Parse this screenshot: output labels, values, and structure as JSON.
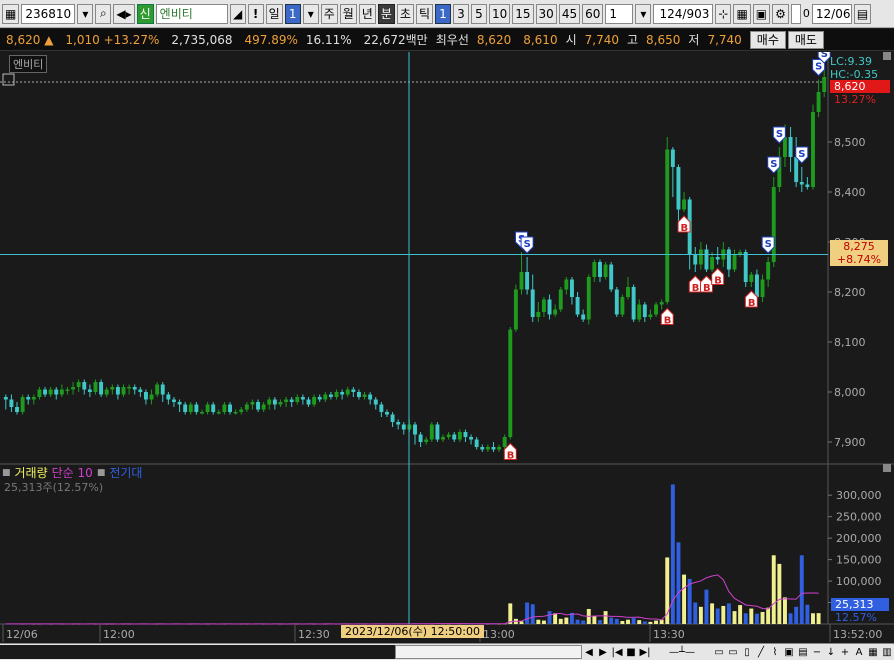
{
  "toolbar": {
    "stock_code": "236810",
    "search_icon": "magnifier-icon",
    "sound_icon": "speaker-icon",
    "shin_badge": "신",
    "stock_name": "엔비티",
    "exclaim": "!",
    "period_buttons": [
      "일",
      "주",
      "월",
      "년",
      "분",
      "초",
      "틱"
    ],
    "active_period": "분",
    "period_count": "1",
    "interval_buttons": [
      "1",
      "3",
      "5",
      "10",
      "15",
      "30",
      "45",
      "60"
    ],
    "active_interval": "1",
    "unit_value": "1",
    "page_counter": "124/903",
    "date_value": "12/06",
    "zero_label": "0"
  },
  "quote": {
    "price": "8,620",
    "arrow": "▲",
    "change": "1,010",
    "change_pct": "+13.27%",
    "volume": "2,735,068",
    "vol_ratio": "497.89%",
    "turnover": "16.11%",
    "amount": "22,672백만",
    "best_label": "최우선",
    "best_ask": "8,620",
    "best_bid": "8,610",
    "open_label": "시",
    "open": "7,740",
    "high_label": "고",
    "high": "8,650",
    "low_label": "저",
    "low": "7,740",
    "buy_button": "매수",
    "sell_button": "매도"
  },
  "chart": {
    "stock_tag": "엔비티",
    "lc": "LC:9.39",
    "hc": "HC:-0.35",
    "last_price": "8,620",
    "last_pct": "13.27%",
    "cross_price": "8,275",
    "cross_pct": "+8.74%",
    "y_ticks": [
      "8,500",
      "8,400",
      "8,300",
      "8,200",
      "8,100",
      "8,000",
      "7,900"
    ],
    "vol_legend_1": "거래량",
    "vol_legend_2": "단순 10",
    "vol_legend_3": "전기대",
    "vol_sub": "25,313주(12.57%)",
    "vol_ticks": [
      "300,000",
      "250,000",
      "200,000",
      "150,000",
      "100,000",
      "50,000"
    ],
    "vol_last": "25,313",
    "vol_last_pct": "12.57%",
    "x_ticks": [
      "12/06",
      "12:00",
      "12:30",
      "13:00",
      "13:30",
      "13:52:00"
    ],
    "cross_time": "2023/12/06(수) 12:50:00",
    "colors": {
      "up": "#1e9a1e",
      "down": "#40c8c8",
      "crosshair": "#40c0d0",
      "vol_up": "#f0f090",
      "vol_down": "#3060e0",
      "ma": "#d040d0",
      "last_tag": "#e01818",
      "cross_tag": "#f0d080"
    }
  },
  "chart_data": {
    "type": "candlestick",
    "ylim": [
      7860,
      8640
    ],
    "candles": [
      [
        7990,
        7985,
        7965,
        7995
      ],
      [
        7985,
        7970,
        7960,
        7995
      ],
      [
        7970,
        7960,
        7955,
        7980
      ],
      [
        7960,
        7990,
        7955,
        7995
      ],
      [
        7990,
        7985,
        7975,
        7995
      ],
      [
        7985,
        7990,
        7975,
        7995
      ],
      [
        7990,
        8005,
        7985,
        8010
      ],
      [
        8005,
        7995,
        7990,
        8010
      ],
      [
        7995,
        8005,
        7990,
        8010
      ],
      [
        8005,
        7995,
        7985,
        8010
      ],
      [
        7995,
        8005,
        7990,
        8015
      ],
      [
        8005,
        8005,
        7995,
        8010
      ],
      [
        8005,
        8010,
        7995,
        8020
      ],
      [
        8010,
        8020,
        8000,
        8025
      ],
      [
        8020,
        8005,
        7995,
        8025
      ],
      [
        8005,
        8000,
        7990,
        8015
      ],
      [
        8000,
        8020,
        7995,
        8025
      ],
      [
        8020,
        7995,
        7990,
        8025
      ],
      [
        7995,
        8005,
        7990,
        8010
      ],
      [
        8005,
        8010,
        7995,
        8015
      ],
      [
        8010,
        7995,
        7985,
        8015
      ],
      [
        7995,
        8010,
        7990,
        8015
      ],
      [
        8010,
        8010,
        7995,
        8015
      ],
      [
        8010,
        8005,
        7995,
        8015
      ],
      [
        8005,
        8000,
        7990,
        8010
      ],
      [
        8000,
        7985,
        7975,
        8005
      ],
      [
        7985,
        7995,
        7975,
        8005
      ],
      [
        7995,
        8015,
        7990,
        8020
      ],
      [
        8015,
        7995,
        7980,
        8020
      ],
      [
        7995,
        7985,
        7975,
        8000
      ],
      [
        7985,
        7980,
        7970,
        7990
      ],
      [
        7980,
        7975,
        7960,
        7985
      ],
      [
        7975,
        7960,
        7955,
        7980
      ],
      [
        7960,
        7975,
        7955,
        7980
      ],
      [
        7975,
        7960,
        7955,
        7980
      ],
      [
        7960,
        7960,
        7955,
        7965
      ],
      [
        7960,
        7975,
        7955,
        7980
      ],
      [
        7975,
        7960,
        7955,
        7980
      ],
      [
        7960,
        7960,
        7955,
        7965
      ],
      [
        7960,
        7975,
        7955,
        7980
      ],
      [
        7975,
        7960,
        7955,
        7980
      ],
      [
        7960,
        7960,
        7955,
        7965
      ],
      [
        7960,
        7965,
        7955,
        7970
      ],
      [
        7965,
        7975,
        7960,
        7980
      ],
      [
        7975,
        7980,
        7965,
        7985
      ],
      [
        7980,
        7965,
        7960,
        7985
      ],
      [
        7965,
        7975,
        7960,
        7980
      ],
      [
        7975,
        7985,
        7965,
        7990
      ],
      [
        7985,
        7975,
        7965,
        7990
      ],
      [
        7975,
        7980,
        7970,
        7985
      ],
      [
        7980,
        7985,
        7970,
        7990
      ],
      [
        7985,
        7980,
        7970,
        7990
      ],
      [
        7980,
        7990,
        7975,
        7995
      ],
      [
        7990,
        7985,
        7975,
        7995
      ],
      [
        7985,
        7975,
        7970,
        7990
      ],
      [
        7975,
        7990,
        7970,
        7995
      ],
      [
        7990,
        7985,
        7980,
        7995
      ],
      [
        7985,
        7995,
        7980,
        8000
      ],
      [
        7995,
        7990,
        7985,
        8000
      ],
      [
        7990,
        8000,
        7985,
        8005
      ],
      [
        8000,
        7995,
        7985,
        8005
      ],
      [
        7995,
        8005,
        7990,
        8010
      ],
      [
        8005,
        8000,
        7990,
        8010
      ],
      [
        8000,
        7990,
        7985,
        8005
      ],
      [
        7990,
        7995,
        7985,
        8000
      ],
      [
        7995,
        7985,
        7975,
        8000
      ],
      [
        7985,
        7975,
        7965,
        7990
      ],
      [
        7975,
        7960,
        7950,
        7980
      ],
      [
        7960,
        7955,
        7950,
        7965
      ],
      [
        7955,
        7940,
        7930,
        7960
      ],
      [
        7940,
        7935,
        7925,
        7945
      ],
      [
        7935,
        7925,
        7915,
        7940
      ],
      [
        7925,
        7935,
        7920,
        7945
      ],
      [
        7935,
        7915,
        7895,
        7940
      ],
      [
        7915,
        7900,
        7890,
        7920
      ],
      [
        7900,
        7905,
        7895,
        7910
      ],
      [
        7905,
        7935,
        7900,
        7940
      ],
      [
        7935,
        7905,
        7900,
        7940
      ],
      [
        7905,
        7910,
        7900,
        7915
      ],
      [
        7910,
        7915,
        7905,
        7920
      ],
      [
        7915,
        7905,
        7900,
        7920
      ],
      [
        7905,
        7920,
        7900,
        7925
      ],
      [
        7920,
        7910,
        7900,
        7925
      ],
      [
        7910,
        7905,
        7895,
        7915
      ],
      [
        7905,
        7890,
        7885,
        7910
      ],
      [
        7890,
        7885,
        7880,
        7895
      ],
      [
        7885,
        7890,
        7880,
        7895
      ],
      [
        7890,
        7885,
        7880,
        7900
      ],
      [
        7885,
        7890,
        7880,
        7895
      ],
      [
        7890,
        7910,
        7885,
        7915
      ],
      [
        7910,
        8125,
        7905,
        8130
      ],
      [
        8125,
        8205,
        8120,
        8215
      ],
      [
        8205,
        8240,
        8195,
        8280
      ],
      [
        8240,
        8205,
        8195,
        8270
      ],
      [
        8205,
        8150,
        8140,
        8235
      ],
      [
        8150,
        8160,
        8140,
        8180
      ],
      [
        8160,
        8185,
        8150,
        8190
      ],
      [
        8185,
        8155,
        8145,
        8195
      ],
      [
        8155,
        8165,
        8150,
        8175
      ],
      [
        8165,
        8205,
        8160,
        8210
      ],
      [
        8205,
        8225,
        8195,
        8230
      ],
      [
        8225,
        8190,
        8175,
        8230
      ],
      [
        8190,
        8155,
        8150,
        8200
      ],
      [
        8155,
        8145,
        8140,
        8165
      ],
      [
        8145,
        8230,
        8135,
        8235
      ],
      [
        8230,
        8260,
        8220,
        8265
      ],
      [
        8260,
        8230,
        8220,
        8265
      ],
      [
        8230,
        8255,
        8225,
        8260
      ],
      [
        8255,
        8205,
        8200,
        8260
      ],
      [
        8205,
        8155,
        8150,
        8210
      ],
      [
        8155,
        8190,
        8150,
        8195
      ],
      [
        8190,
        8210,
        8185,
        8230
      ],
      [
        8210,
        8145,
        8140,
        8215
      ],
      [
        8145,
        8175,
        8140,
        8185
      ],
      [
        8175,
        8150,
        8140,
        8180
      ],
      [
        8150,
        8155,
        8145,
        8165
      ],
      [
        8155,
        8175,
        8150,
        8180
      ],
      [
        8175,
        8180,
        8165,
        8185
      ],
      [
        8180,
        8485,
        8175,
        8510
      ],
      [
        8485,
        8450,
        8390,
        8490
      ],
      [
        8450,
        8365,
        8340,
        8455
      ],
      [
        8365,
        8385,
        8360,
        8400
      ],
      [
        8385,
        8275,
        8245,
        8390
      ],
      [
        8275,
        8255,
        8240,
        8290
      ],
      [
        8255,
        8285,
        8245,
        8300
      ],
      [
        8285,
        8245,
        8240,
        8295
      ],
      [
        8245,
        8270,
        8240,
        8280
      ],
      [
        8270,
        8265,
        8255,
        8290
      ],
      [
        8265,
        8285,
        8250,
        8300
      ],
      [
        8285,
        8245,
        8230,
        8290
      ],
      [
        8245,
        8275,
        8240,
        8285
      ],
      [
        8275,
        8280,
        8270,
        8285
      ],
      [
        8280,
        8220,
        8210,
        8285
      ],
      [
        8220,
        8235,
        8210,
        8240
      ],
      [
        8235,
        8190,
        8175,
        8245
      ],
      [
        8190,
        8225,
        8180,
        8235
      ],
      [
        8225,
        8260,
        8210,
        8270
      ],
      [
        8260,
        8410,
        8250,
        8430
      ],
      [
        8410,
        8470,
        8400,
        8490
      ],
      [
        8470,
        8510,
        8450,
        8535
      ],
      [
        8510,
        8470,
        8440,
        8530
      ],
      [
        8470,
        8420,
        8410,
        8510
      ],
      [
        8420,
        8415,
        8400,
        8450
      ],
      [
        8415,
        8410,
        8405,
        8430
      ],
      [
        8410,
        8560,
        8405,
        8575
      ],
      [
        8560,
        8600,
        8550,
        8625
      ],
      [
        8600,
        8630,
        8590,
        8650
      ]
    ],
    "volumes": [
      200,
      150,
      100,
      150,
      200,
      100,
      150,
      200,
      100,
      150,
      200,
      100,
      150,
      200,
      100,
      150,
      200,
      100,
      150,
      200,
      100,
      150,
      200,
      100,
      150,
      200,
      100,
      150,
      200,
      100,
      150,
      200,
      100,
      150,
      200,
      100,
      150,
      200,
      100,
      150,
      200,
      100,
      150,
      200,
      100,
      150,
      200,
      100,
      150,
      200,
      100,
      150,
      200,
      100,
      150,
      200,
      100,
      150,
      200,
      100,
      150,
      200,
      100,
      150,
      200,
      100,
      150,
      200,
      100,
      150,
      1000,
      800,
      600,
      1500,
      1200,
      900,
      600,
      800,
      700,
      500,
      600,
      800,
      600,
      500,
      700,
      400,
      500,
      300,
      400,
      600,
      48000,
      12000,
      6000,
      50000,
      46000,
      10000,
      8000,
      30000,
      25000,
      12000,
      15000,
      26000,
      10000,
      8000,
      35000,
      18000,
      9000,
      30000,
      15000,
      12000,
      7000,
      10000,
      14000,
      9000,
      6000,
      5000,
      8000,
      10000,
      155000,
      325000,
      190000,
      115000,
      105000,
      50000,
      40000,
      80000,
      48000,
      36000,
      42000,
      48000,
      30000,
      44000,
      25000,
      36000,
      24000,
      28000,
      38000,
      160000,
      140000,
      62000,
      25000,
      40000,
      160000,
      45000,
      25000,
      25313
    ],
    "crosshair": {
      "time": "2023/12/06(수) 12:50:00",
      "price": 8275
    },
    "signals": [
      {
        "i": 90,
        "type": "B"
      },
      {
        "i": 92,
        "type": "S"
      },
      {
        "i": 93,
        "type": "S"
      },
      {
        "i": 118,
        "type": "B"
      },
      {
        "i": 121,
        "type": "B"
      },
      {
        "i": 123,
        "type": "B"
      },
      {
        "i": 125,
        "type": "B"
      },
      {
        "i": 127,
        "type": "B"
      },
      {
        "i": 133,
        "type": "B"
      },
      {
        "i": 136,
        "type": "S"
      },
      {
        "i": 137,
        "type": "S"
      },
      {
        "i": 138,
        "type": "S"
      },
      {
        "i": 142,
        "type": "S"
      },
      {
        "i": 145,
        "type": "S"
      },
      {
        "i": 146,
        "type": "S"
      }
    ]
  }
}
